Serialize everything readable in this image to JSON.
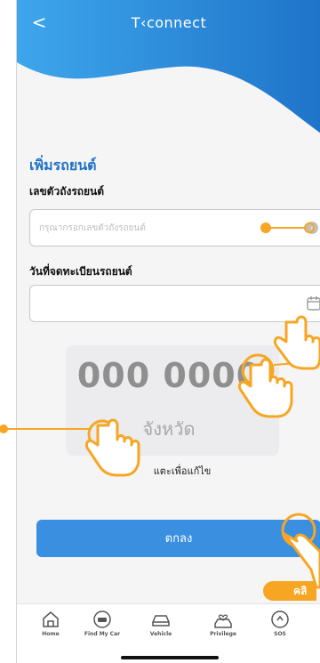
{
  "header": {
    "brand": "T‹connect",
    "back_glyph": "<"
  },
  "form": {
    "title": "เพิ่มรถยนต์",
    "vin_label": "เลขตัวถังรถยนต์",
    "vin_placeholder": "กรุณากรอกเลขตัวถังรถยนต์",
    "reg_date_label": "วันที่จดทะเบียนรถยนต์"
  },
  "plate": {
    "number": "000 0000",
    "province": "จังหวัด",
    "edit_hint": "แตะเพื่อแก้ไข"
  },
  "actions": {
    "confirm_label": "ตกลง",
    "click_tag": "คลิ"
  },
  "bottom_nav": {
    "items": [
      {
        "label": "Home",
        "icon": "home-icon"
      },
      {
        "label": "Find My Car",
        "icon": "find-car-icon"
      },
      {
        "label": "Vehicle",
        "icon": "vehicle-icon"
      },
      {
        "label": "Privilege",
        "icon": "privilege-icon"
      },
      {
        "label": "SOS",
        "icon": "sos-icon"
      }
    ]
  },
  "colors": {
    "accent_blue": "#1e73c8",
    "button_blue": "#3a8fe0",
    "tutorial_orange": "#f6a623"
  }
}
